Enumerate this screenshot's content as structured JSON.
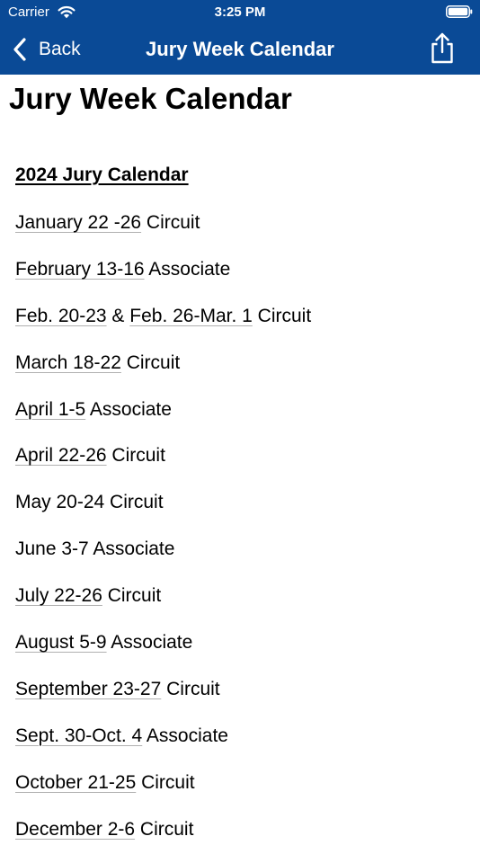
{
  "status_bar": {
    "carrier": "Carrier",
    "time": "3:25 PM",
    "wifi_icon": "wifi-icon",
    "battery_icon": "battery-icon"
  },
  "nav_bar": {
    "back_label": "Back",
    "title": "Jury Week Calendar",
    "back_icon": "chevron-left-icon",
    "share_icon": "share-icon",
    "background_color": "#0a4a96",
    "text_color": "#ffffff"
  },
  "page": {
    "heading": "Jury Week Calendar",
    "calendar_heading": "2024 Jury Calendar",
    "entries": [
      {
        "parts": [
          {
            "text": "January 22 -26",
            "link": true
          },
          {
            "text": " Circuit",
            "link": false
          }
        ]
      },
      {
        "parts": [
          {
            "text": "February 13-16",
            "link": true
          },
          {
            "text": " Associate",
            "link": false
          }
        ]
      },
      {
        "parts": [
          {
            "text": "Feb. 20-23",
            "link": true
          },
          {
            "text": " & ",
            "link": false
          },
          {
            "text": "Feb. 26-Mar. 1",
            "link": true
          },
          {
            "text": " Circuit",
            "link": false
          }
        ]
      },
      {
        "parts": [
          {
            "text": "March 18-22",
            "link": true
          },
          {
            "text": " Circuit",
            "link": false
          }
        ]
      },
      {
        "parts": [
          {
            "text": "April 1-5",
            "link": true
          },
          {
            "text": " Associate",
            "link": false
          }
        ]
      },
      {
        "parts": [
          {
            "text": "April 22-26",
            "link": true
          },
          {
            "text": " Circuit",
            "link": false
          }
        ]
      },
      {
        "parts": [
          {
            "text": "May 20-24 Circuit",
            "link": false
          }
        ]
      },
      {
        "parts": [
          {
            "text": "June 3-7 Associate",
            "link": false
          }
        ]
      },
      {
        "parts": [
          {
            "text": "July 22-26",
            "link": true
          },
          {
            "text": " Circuit",
            "link": false
          }
        ]
      },
      {
        "parts": [
          {
            "text": "August 5-9",
            "link": true
          },
          {
            "text": " Associate",
            "link": false
          }
        ]
      },
      {
        "parts": [
          {
            "text": "September 23-27",
            "link": true
          },
          {
            "text": " Circuit",
            "link": false
          }
        ]
      },
      {
        "parts": [
          {
            "text": "Sept. 30-Oct. 4",
            "link": true
          },
          {
            "text": " Associate",
            "link": false
          }
        ]
      },
      {
        "parts": [
          {
            "text": "October 21-25",
            "link": true
          },
          {
            "text": " Circuit",
            "link": false
          }
        ]
      },
      {
        "parts": [
          {
            "text": "December 2-6",
            "link": true
          },
          {
            "text": " Circuit",
            "link": false
          }
        ]
      }
    ]
  }
}
